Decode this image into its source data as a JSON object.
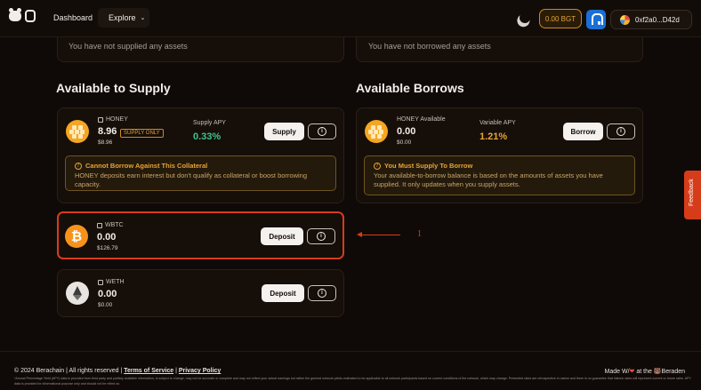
{
  "nav": {
    "dashboard": "Dashboard",
    "explore": "Explore",
    "bgt_balance": "0.00 BGT",
    "wallet": "0xf2a0...D42d"
  },
  "supplied": {
    "empty_text": "You have not supplied any assets"
  },
  "borrowed": {
    "empty_text": "You have not borrowed any assets"
  },
  "supply_section": {
    "title": "Available to Supply",
    "honey": {
      "symbol": "HONEY",
      "amount": "8.96",
      "usd": "$8.96",
      "tag": "SUPPLY ONLY",
      "apy_label": "Supply APY",
      "apy_value": "0.33%",
      "button": "Supply",
      "warn_title": "Cannot Borrow Against This Collateral",
      "warn_text": "HONEY deposits earn interest but don't qualify as collateral or boost borrowing capacity."
    },
    "wbtc": {
      "symbol": "WBTC",
      "amount": "0.00",
      "usd": "$126.79",
      "button": "Deposit"
    },
    "weth": {
      "symbol": "WETH",
      "amount": "0.00",
      "usd": "$0.00",
      "button": "Deposit"
    }
  },
  "borrow_section": {
    "title": "Available Borrows",
    "honey": {
      "label": "HONEY Available",
      "amount": "0.00",
      "usd": "$0.00",
      "apy_label": "Variable APY",
      "apy_value": "1.21%",
      "button": "Borrow",
      "warn_title": "You Must Supply To Borrow",
      "warn_text": "Your available-to-borrow balance is based on the amounts of assets you have supplied. It only updates when you supply assets."
    }
  },
  "annotation": {
    "number": "1"
  },
  "feedback": "Feedback",
  "footer": {
    "copyright": "© 2024 Berachain | All rights reserved |",
    "terms": "Terms of Service",
    "sep": "|",
    "privacy": "Privacy Policy",
    "made_prefix": "Made W/",
    "made_suffix": "at the 🐻Beraden",
    "disclaimer": "*Annual Percentage Yield (APY) data is provided from third party and publicly available information, is subject to change, may not be accurate or complete and may not reflect your actual earnings but rather the general network yields estimated to be applicable to all network participants based on current conditions of the network, which may change. Presented rates are retrospective in nature and there is no guarantee that historic rates will represent current or future rates. APY data is provided for informational purpose only and should not be relied on."
  },
  "colors": {
    "accent": "#e7a336",
    "green": "#3ec28f",
    "highlight": "#d63c1a"
  }
}
